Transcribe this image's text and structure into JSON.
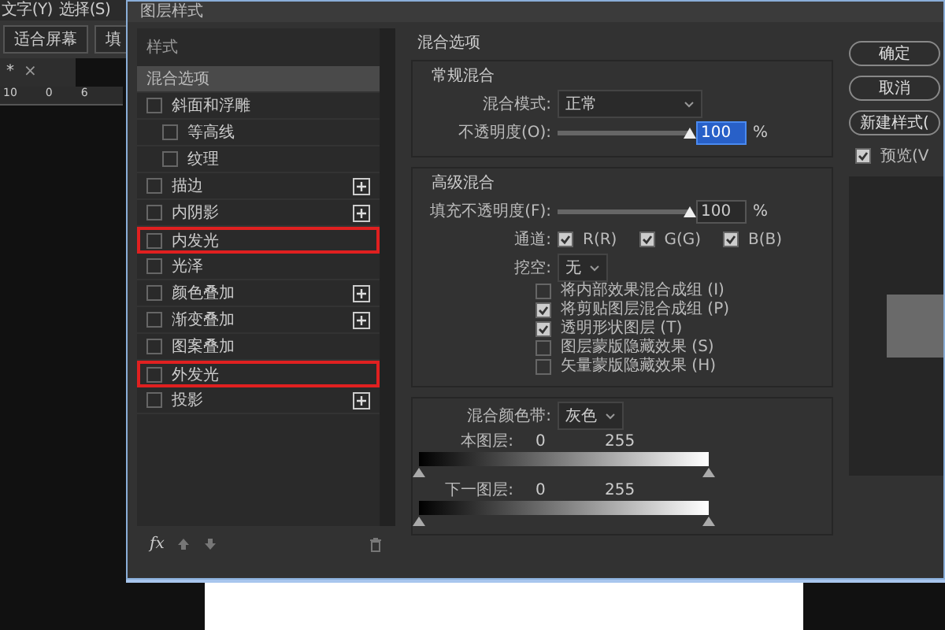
{
  "app": {
    "menu": [
      "文字(Y)",
      "选择(S)"
    ],
    "toolbar_buttons": [
      "适合屏幕",
      "填"
    ],
    "doc_tab": {
      "label": "*",
      "close": "×"
    },
    "ruler_labels": [
      "10",
      "0",
      "6"
    ]
  },
  "window": {
    "title": "图层样式"
  },
  "styles_panel": {
    "heading": "样式",
    "items": [
      {
        "label": "混合选项",
        "kind": "header",
        "selected": true,
        "highlighted": false
      },
      {
        "label": "斜面和浮雕",
        "kind": "effect",
        "checked": false,
        "selected": false,
        "add": false,
        "highlighted": false,
        "children": [
          {
            "label": "等高线",
            "kind": "effect",
            "checked": false,
            "selected": false,
            "add": false,
            "highlighted": false
          },
          {
            "label": "纹理",
            "kind": "effect",
            "checked": false,
            "selected": false,
            "add": false,
            "highlighted": false
          }
        ]
      },
      {
        "label": "描边",
        "kind": "effect",
        "checked": false,
        "selected": false,
        "add": true,
        "highlighted": false
      },
      {
        "label": "内阴影",
        "kind": "effect",
        "checked": false,
        "selected": false,
        "add": true,
        "highlighted": false
      },
      {
        "label": "内发光",
        "kind": "effect",
        "checked": false,
        "selected": false,
        "add": false,
        "highlighted": true
      },
      {
        "label": "光泽",
        "kind": "effect",
        "checked": false,
        "selected": false,
        "add": false,
        "highlighted": false
      },
      {
        "label": "颜色叠加",
        "kind": "effect",
        "checked": false,
        "selected": false,
        "add": true,
        "highlighted": false
      },
      {
        "label": "渐变叠加",
        "kind": "effect",
        "checked": false,
        "selected": false,
        "add": true,
        "highlighted": false
      },
      {
        "label": "图案叠加",
        "kind": "effect",
        "checked": false,
        "selected": false,
        "add": false,
        "highlighted": false
      },
      {
        "label": "外发光",
        "kind": "effect",
        "checked": false,
        "selected": false,
        "add": false,
        "highlighted": true
      },
      {
        "label": "投影",
        "kind": "effect",
        "checked": false,
        "selected": false,
        "add": true,
        "highlighted": false
      }
    ],
    "footer": {
      "fx": "fx"
    }
  },
  "blending": {
    "title": "混合选项",
    "general": {
      "title": "常规混合",
      "mode_label": "混合模式:",
      "mode": "正常",
      "opacity": {
        "label": "不透明度(O):",
        "level": 1,
        "value": "100",
        "selected": true,
        "unit": "%"
      }
    },
    "advanced": {
      "title": "高级混合",
      "fill_opacity": {
        "label": "填充不透明度(F):",
        "level": 1,
        "value": "100",
        "selected": false,
        "unit": "%"
      },
      "channels_label": "通道:",
      "channels": [
        {
          "label": "R(R)",
          "checked": true
        },
        {
          "label": "G(G)",
          "checked": true
        },
        {
          "label": "B(B)",
          "checked": true
        }
      ],
      "knockout_label": "挖空:",
      "knockout": "无",
      "options": [
        {
          "label": "将内部效果混合成组 (I)",
          "checked": false
        },
        {
          "label": "将剪贴图层混合成组 (P)",
          "checked": true
        },
        {
          "label": "透明形状图层 (T)",
          "checked": true
        },
        {
          "label": "图层蒙版隐藏效果 (S)",
          "checked": false
        },
        {
          "label": "矢量蒙版隐藏效果 (H)",
          "checked": false
        }
      ]
    },
    "blend_if": {
      "label": "混合颜色带:",
      "value": "灰色",
      "bands": [
        {
          "label": "本图层:",
          "low": "0",
          "high": "255",
          "thumbs": [
            {
              "level": 0
            },
            {
              "level": 1
            }
          ]
        },
        {
          "label": "下一图层:",
          "low": "0",
          "high": "255",
          "thumbs": [
            {
              "level": 0
            },
            {
              "level": 1
            }
          ]
        }
      ]
    }
  },
  "buttons": [
    "确定",
    "取消",
    "新建样式("
  ],
  "preview": {
    "label": "预览(V",
    "checked": true
  }
}
